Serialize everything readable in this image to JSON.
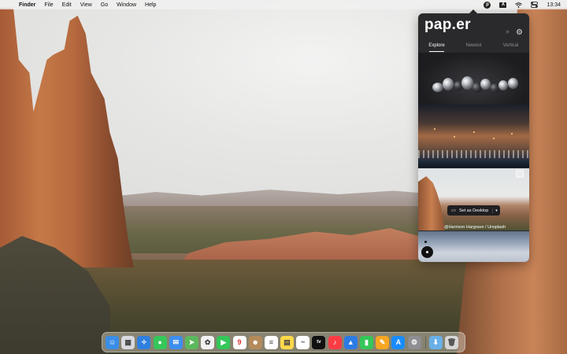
{
  "menubar": {
    "apple_icon": "apple-logo",
    "app_name": "Finder",
    "menus": [
      "File",
      "Edit",
      "View",
      "Go",
      "Window",
      "Help"
    ],
    "tray": {
      "paper_label": "p",
      "input_label": "A",
      "wifi_icon": "wifi-icon",
      "control_center_icon": "control-center-icon",
      "clock": "13:34"
    }
  },
  "popover": {
    "logo": "pap.er",
    "tabs": [
      {
        "label": "Explore",
        "active": true
      },
      {
        "label": "Newest",
        "active": false
      },
      {
        "label": "Vertical",
        "active": false
      }
    ],
    "set_desktop_label": "Set as Desktop",
    "credit": "@Harrison Hargrave / Unsplash"
  },
  "dock": {
    "icons": [
      {
        "name": "finder",
        "color": "#3a8ee6",
        "glyph": "☺"
      },
      {
        "name": "launchpad",
        "color": "#d9d9e0",
        "glyph": "▦"
      },
      {
        "name": "safari",
        "color": "#2f7fe0",
        "glyph": "✧"
      },
      {
        "name": "messages",
        "color": "#35c759",
        "glyph": "●"
      },
      {
        "name": "mail",
        "color": "#3d8ef0",
        "glyph": "✉"
      },
      {
        "name": "maps",
        "color": "#5cb85c",
        "glyph": "➤"
      },
      {
        "name": "photos",
        "color": "#f2f2f2",
        "glyph": "✿"
      },
      {
        "name": "facetime",
        "color": "#34c759",
        "glyph": "▶"
      },
      {
        "name": "calendar",
        "color": "#ffffff",
        "glyph": "9"
      },
      {
        "name": "contacts",
        "color": "#b58a5b",
        "glyph": "☻"
      },
      {
        "name": "reminders",
        "color": "#ffffff",
        "glyph": "≡"
      },
      {
        "name": "notes",
        "color": "#ffd84a",
        "glyph": "▤"
      },
      {
        "name": "freeform",
        "color": "#ffffff",
        "glyph": "~"
      },
      {
        "name": "tv",
        "color": "#111111",
        "glyph": "tv"
      },
      {
        "name": "music",
        "color": "#fc3c44",
        "glyph": "♪"
      },
      {
        "name": "keynote",
        "color": "#2c7be5",
        "glyph": "▲"
      },
      {
        "name": "numbers",
        "color": "#34c759",
        "glyph": "▮"
      },
      {
        "name": "pages",
        "color": "#f6a623",
        "glyph": "✎"
      },
      {
        "name": "app-store",
        "color": "#1a8cff",
        "glyph": "A"
      },
      {
        "name": "system-settings",
        "color": "#8e8e93",
        "glyph": "⚙"
      },
      {
        "name": "downloads-folder",
        "color": "#6ab0e8",
        "glyph": "⬇"
      },
      {
        "name": "trash",
        "color": "#d6d6d6",
        "glyph": "🗑"
      }
    ]
  }
}
